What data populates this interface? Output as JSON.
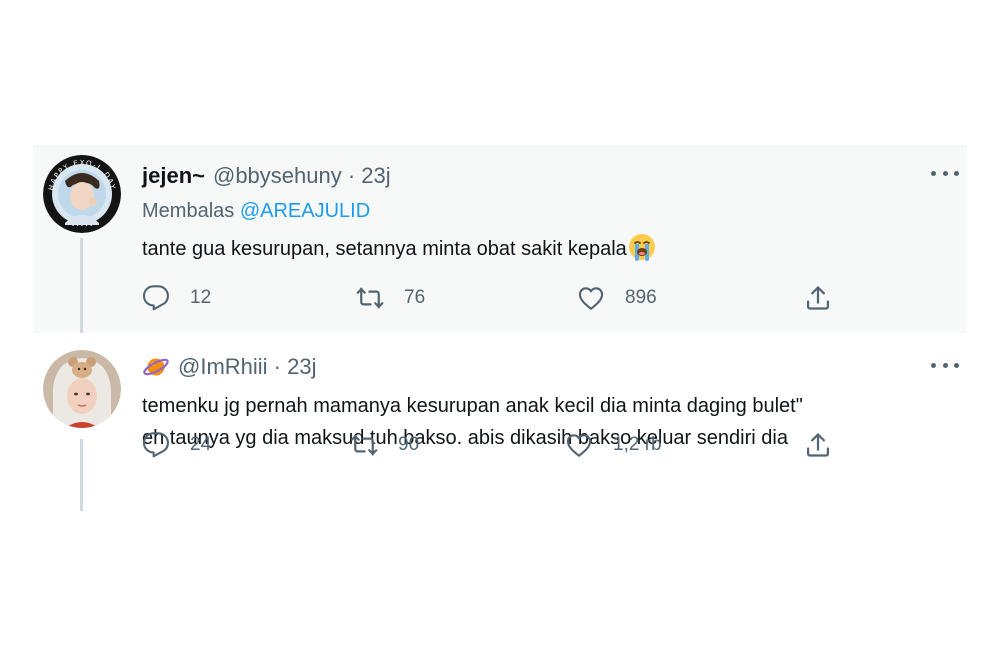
{
  "tweets": [
    {
      "display_name": "jejen~",
      "meta": "@bbysehuny · 23j",
      "reply_prefix": "Membalas ",
      "reply_mention": "@AREAJULID",
      "text": "tante gua kesurupan, setannya minta obat sakit kepala",
      "text_emoji": "loudly-crying-face",
      "avatar_text": "HAPPY EXO-L DAY",
      "actions": {
        "replies": "12",
        "retweets": "76",
        "likes": "896"
      }
    },
    {
      "name_emoji": "ringed-planet",
      "meta": "@ImRhiii · 23j",
      "text_lines": [
        "temenku jg pernah mamanya kesurupan anak kecil dia minta daging bulet\"",
        "eh taunya yg dia maksud tuh bakso. abis dikasih bakso keluar sendiri dia"
      ],
      "actions": {
        "replies": "24",
        "retweets": "90",
        "likes": "1,2 rb"
      }
    }
  ],
  "icons": {
    "reply": "reply-icon",
    "retweet": "retweet-icon",
    "like": "heart-icon",
    "share": "share-icon",
    "more": "more-icon"
  },
  "colors": {
    "link": "#1d9bf0",
    "muted": "#536471",
    "text": "#0f1419",
    "highlight_bg": "#f7f9f9"
  }
}
